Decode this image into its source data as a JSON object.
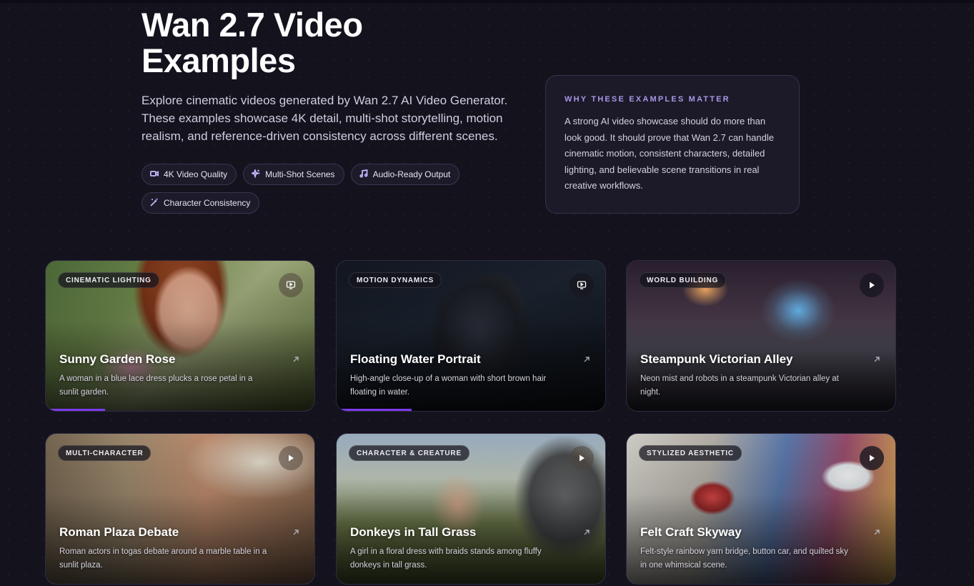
{
  "hero": {
    "title": "Wan 2.7 Video Examples",
    "subtitle": "Explore cinematic videos generated by Wan 2.7 AI Video Generator. These examples showcase 4K detail, multi-shot storytelling, motion realism, and reference-driven consistency across different scenes.",
    "chips": [
      {
        "label": "4K Video Quality",
        "icon": "video-icon"
      },
      {
        "label": "Multi-Shot Scenes",
        "icon": "sparkles-icon"
      },
      {
        "label": "Audio-Ready Output",
        "icon": "music-icon"
      },
      {
        "label": "Character Consistency",
        "icon": "wand-icon"
      }
    ]
  },
  "why": {
    "heading": "WHY THESE EXAMPLES MATTER",
    "body": "A strong AI video showcase should do more than look good. It should prove that Wan 2.7 can handle cinematic motion, consistent characters, detailed lighting, and believable scene transitions in real creative workflows."
  },
  "cards": [
    {
      "badge": "CINEMATIC LIGHTING",
      "title": "Sunny Garden Rose",
      "description": "A woman in a blue lace dress plucks a rose petal in a sunlit garden.",
      "control": "screen-play-icon",
      "progress": 0.22
    },
    {
      "badge": "MOTION DYNAMICS",
      "title": "Floating Water Portrait",
      "description": "High-angle close-up of a woman with short brown hair floating in water.",
      "control": "screen-play-icon",
      "progress": 0.28
    },
    {
      "badge": "WORLD BUILDING",
      "title": "Steampunk Victorian Alley",
      "description": "Neon mist and robots in a steampunk Victorian alley at night.",
      "control": "play-icon"
    },
    {
      "badge": "MULTI-CHARACTER",
      "title": "Roman Plaza Debate",
      "description": "Roman actors in togas debate around a marble table in a sunlit plaza.",
      "control": "play-icon"
    },
    {
      "badge": "CHARACTER & CREATURE",
      "title": "Donkeys in Tall Grass",
      "description": "A girl in a floral dress with braids stands among fluffy donkeys in tall grass.",
      "control": "play-icon"
    },
    {
      "badge": "STYLIZED AESTHETIC",
      "title": "Felt Craft Skyway",
      "description": "Felt-style rainbow yarn bridge, button car, and quilted sky in one whimsical scene.",
      "control": "play-icon"
    }
  ],
  "colors": {
    "accent": "#7c3aed",
    "heading_accent": "#a997e8",
    "background": "#14121d"
  }
}
